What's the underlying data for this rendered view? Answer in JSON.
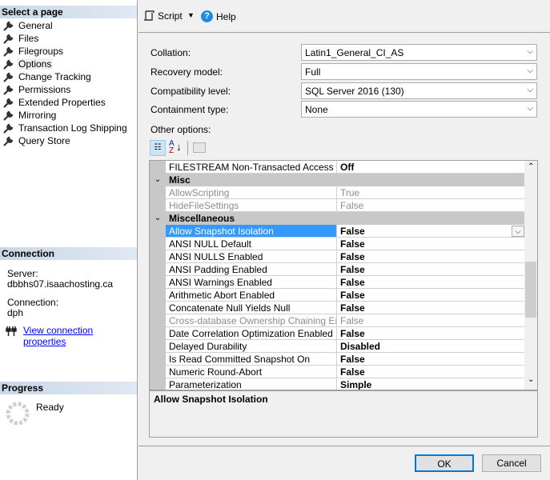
{
  "left": {
    "select_header": "Select a page",
    "pages": [
      {
        "label": "General"
      },
      {
        "label": "Files"
      },
      {
        "label": "Filegroups"
      },
      {
        "label": "Options",
        "selected": true
      },
      {
        "label": "Change Tracking"
      },
      {
        "label": "Permissions"
      },
      {
        "label": "Extended Properties"
      },
      {
        "label": "Mirroring"
      },
      {
        "label": "Transaction Log Shipping"
      },
      {
        "label": "Query Store"
      }
    ],
    "connection_header": "Connection",
    "server_label": "Server:",
    "server_value": "dbbhs07.isaachosting.ca",
    "connection_label": "Connection:",
    "connection_value": "dph",
    "view_link": "View connection properties",
    "progress_header": "Progress",
    "progress_status": "Ready"
  },
  "toolbar": {
    "script": "Script",
    "help": "Help"
  },
  "form": {
    "collation_label": "Collation:",
    "collation": "Latin1_General_CI_AS",
    "recovery_label": "Recovery model:",
    "recovery": "Full",
    "compat_label": "Compatibility level:",
    "compat": "SQL Server 2016 (130)",
    "containment_label": "Containment type:",
    "containment": "None",
    "other_label": "Other options:"
  },
  "grid": {
    "rows": [
      {
        "name": "FILESTREAM Non-Transacted Access",
        "value": "Off"
      },
      {
        "name": "Misc",
        "category": true
      },
      {
        "name": "AllowScripting",
        "value": "True",
        "disabled": true
      },
      {
        "name": "HideFileSettings",
        "value": "False",
        "disabled": true
      },
      {
        "name": "Miscellaneous",
        "category": true
      },
      {
        "name": "Allow Snapshot Isolation",
        "value": "False",
        "selected": true
      },
      {
        "name": "ANSI NULL Default",
        "value": "False"
      },
      {
        "name": "ANSI NULLS Enabled",
        "value": "False"
      },
      {
        "name": "ANSI Padding Enabled",
        "value": "False"
      },
      {
        "name": "ANSI Warnings Enabled",
        "value": "False"
      },
      {
        "name": "Arithmetic Abort Enabled",
        "value": "False"
      },
      {
        "name": "Concatenate Null Yields Null",
        "value": "False"
      },
      {
        "name": "Cross-database Ownership Chaining Enabled",
        "value": "False",
        "disabled": true
      },
      {
        "name": "Date Correlation Optimization Enabled",
        "value": "False"
      },
      {
        "name": "Delayed Durability",
        "value": "Disabled"
      },
      {
        "name": "Is Read Committed Snapshot On",
        "value": "False"
      },
      {
        "name": "Numeric Round-Abort",
        "value": "False"
      },
      {
        "name": "Parameterization",
        "value": "Simple"
      }
    ],
    "description": "Allow Snapshot Isolation"
  },
  "buttons": {
    "ok": "OK",
    "cancel": "Cancel"
  },
  "colors": {
    "selection": "#3399ff",
    "link": "#0000ff",
    "header": "#c9d7e6"
  }
}
